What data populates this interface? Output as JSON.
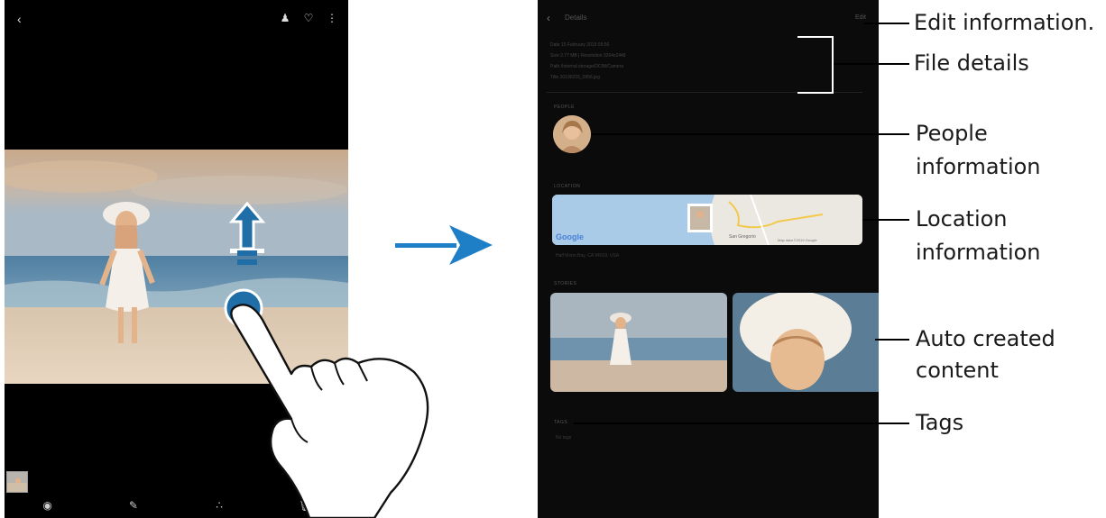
{
  "left_phone": {
    "top_icons": [
      "back-icon",
      "people-icon",
      "heart-icon",
      "more-icon"
    ],
    "bottom_icons": [
      "eye-icon",
      "edit-icon",
      "share-icon",
      "delete-icon"
    ]
  },
  "right_phone": {
    "header": {
      "title": "Details",
      "edit": "Edit"
    },
    "details_rows": [
      "Date  15 February 2019  09:56",
      "Size  2.77 MB  |  Resolution  3264x2448",
      "Path  /Internal storage/DCIM/Camera",
      "Title  20190215_0956.jpg"
    ],
    "sections": {
      "people": "PEOPLE",
      "location": "LOCATION",
      "stories": "STORIES",
      "tags": "TAGS"
    },
    "map": {
      "brand": "Google",
      "place": "San Gregorio",
      "copyright": "Map data ©2019 Google"
    },
    "location_caption": "Half Moon Bay, CA 94019, USA",
    "tags_value": "No tags"
  },
  "labels": {
    "edit_information": "Edit information.",
    "file_details": "File details",
    "people_information": [
      "People",
      "information"
    ],
    "location_information": [
      "Location",
      "information"
    ],
    "auto_created_content": [
      "Auto created",
      "content"
    ],
    "tags": "Tags"
  },
  "colors": {
    "accent_blue": "#1a6fb3",
    "arrow_blue": "#1f7fc6",
    "label_text": "#1a1a1a"
  }
}
